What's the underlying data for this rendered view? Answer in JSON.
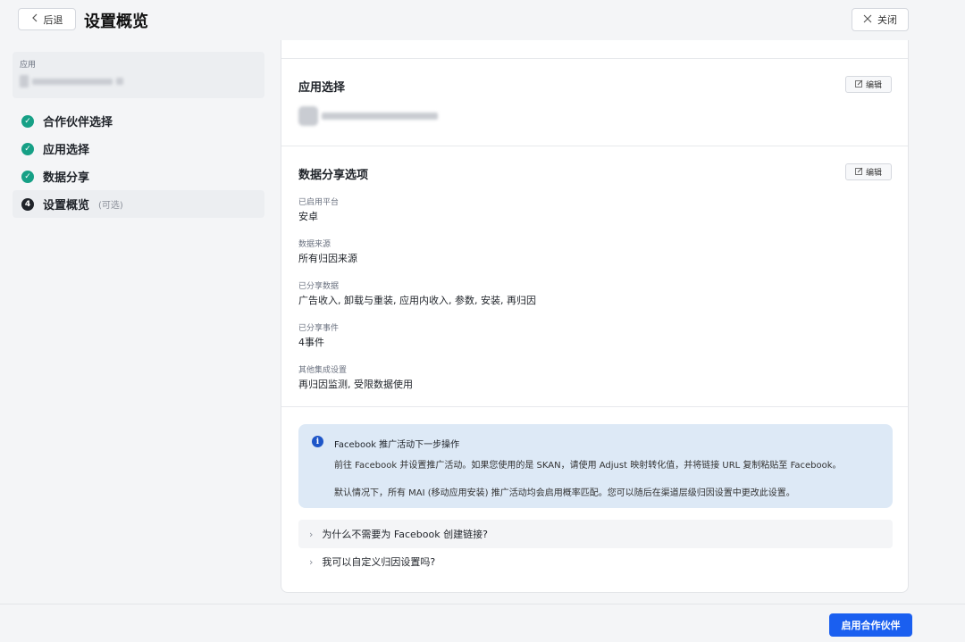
{
  "header": {
    "back_label": "后退",
    "title": "设置概览",
    "close_label": "关闭"
  },
  "sidebar": {
    "app_label": "应用",
    "steps": [
      {
        "label": "合作伙伴选择",
        "status": "done"
      },
      {
        "label": "应用选择",
        "status": "done"
      },
      {
        "label": "数据分享",
        "status": "done"
      },
      {
        "label": "设置概览",
        "status": "current",
        "number": "4",
        "optional": "(可选)"
      }
    ]
  },
  "main": {
    "app_section": {
      "title": "应用选择",
      "edit_label": "编辑"
    },
    "data_section": {
      "title": "数据分享选项",
      "edit_label": "编辑",
      "fields": [
        {
          "label": "已启用平台",
          "value": "安卓"
        },
        {
          "label": "数据来源",
          "value": "所有归因来源"
        },
        {
          "label": "已分享数据",
          "value": "广告收入, 卸载与重装, 应用内收入, 参数, 安装, 再归因"
        },
        {
          "label": "已分享事件",
          "value": "4事件"
        },
        {
          "label": "其他集成设置",
          "value": "再归因监测, 受限数据使用"
        }
      ]
    },
    "info": {
      "icon": "i",
      "title": "Facebook 推广活动下一步操作",
      "line1": "前往 Facebook 并设置推广活动。如果您使用的是 SKAN，请使用 Adjust 映射转化值，并将链接 URL 复制粘贴至 Facebook。",
      "line2": "默认情况下，所有 MAI (移动应用安装) 推广活动均会启用概率匹配。您可以随后在渠道层级归因设置中更改此设置。"
    },
    "faq": [
      {
        "label": "为什么不需要为 Facebook 创建链接?"
      },
      {
        "label": "我可以自定义归因设置吗?"
      }
    ]
  },
  "footer": {
    "primary_label": "启用合作伙伴"
  },
  "colors": {
    "accent": "#1a5ff0",
    "success": "#16a086",
    "info_bg": "#dde9f6"
  }
}
